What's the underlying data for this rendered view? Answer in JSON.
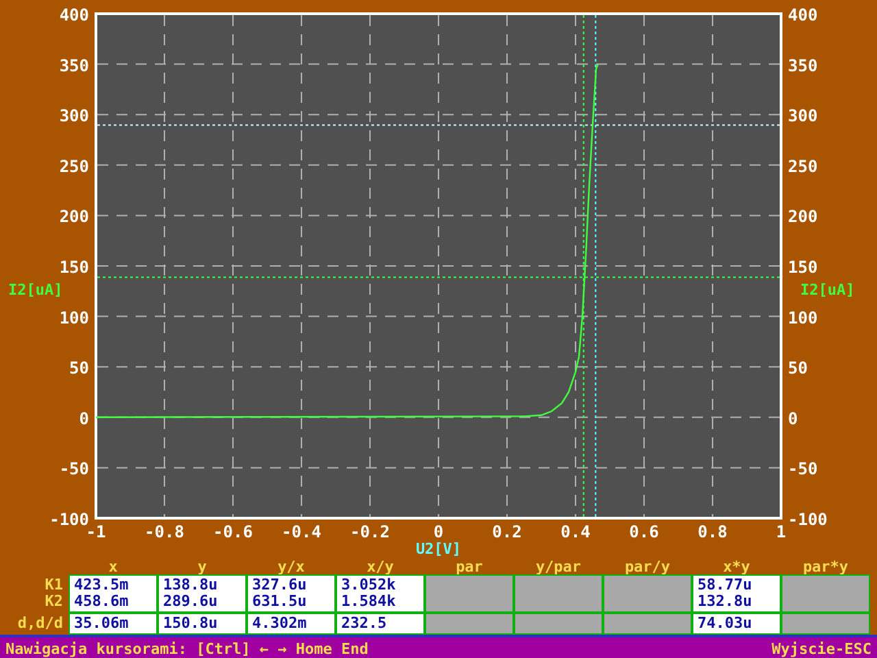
{
  "plot": {
    "chart_data": {
      "type": "line",
      "xlabel": "U2[V]",
      "ylabel": "I2[uA]",
      "xlim": [
        -1,
        1
      ],
      "ylim": [
        -100,
        400
      ],
      "grid": true,
      "xticks": [
        -1,
        -0.8,
        -0.6,
        -0.4,
        -0.2,
        0,
        0.2,
        0.4,
        0.6,
        0.8,
        1
      ],
      "yticks": [
        -100,
        -50,
        0,
        50,
        100,
        150,
        200,
        250,
        300,
        350,
        400
      ],
      "series": [
        {
          "color": "#40ff40",
          "x": [
            -1,
            0.25,
            0.3,
            0.33,
            0.36,
            0.38,
            0.4,
            0.41,
            0.42,
            0.43,
            0.44,
            0.45,
            0.46,
            0.465
          ],
          "values": [
            0,
            1,
            2,
            6,
            14,
            25,
            45,
            60,
            100,
            160,
            230,
            290,
            345,
            350
          ]
        }
      ],
      "ref_lines": [
        {
          "axis": "x",
          "value": 0.4235,
          "color": "#40ff40"
        },
        {
          "axis": "x",
          "value": 0.4586,
          "color": "#60ffff"
        },
        {
          "axis": "y",
          "value": 138.8,
          "color": "#40ff40"
        },
        {
          "axis": "y",
          "value": 289.6,
          "color": "#c0ffff"
        }
      ]
    },
    "right_yticks": [
      "400",
      "350",
      "300",
      "250",
      "200",
      "150",
      "100",
      "50",
      "0",
      "-50",
      "-100"
    ],
    "right_ylabel": "I2[uA]"
  },
  "table": {
    "columns": [
      "x",
      "y",
      "y/x",
      "x/y",
      "par",
      "y/par",
      "par/y",
      "x*y",
      "par*y"
    ],
    "blocks": [
      {
        "labels": [
          "K1",
          "K2"
        ],
        "cells": [
          {
            "kind": "value",
            "lines": [
              "423.5m",
              "458.6m"
            ]
          },
          {
            "kind": "value",
            "lines": [
              "138.8u",
              "289.6u"
            ]
          },
          {
            "kind": "value",
            "lines": [
              "327.6u",
              "631.5u"
            ]
          },
          {
            "kind": "value",
            "lines": [
              "3.052k",
              "1.584k"
            ]
          },
          {
            "kind": "blank"
          },
          {
            "kind": "blank"
          },
          {
            "kind": "blank"
          },
          {
            "kind": "value",
            "lines": [
              "58.77u",
              "132.8u"
            ]
          },
          {
            "kind": "blank"
          }
        ]
      },
      {
        "labels": [
          "d,d/d"
        ],
        "cells": [
          {
            "kind": "value",
            "lines": [
              "35.06m"
            ]
          },
          {
            "kind": "value",
            "lines": [
              "150.8u"
            ]
          },
          {
            "kind": "value",
            "lines": [
              "4.302m"
            ]
          },
          {
            "kind": "value",
            "lines": [
              "232.5"
            ]
          },
          {
            "kind": "blank"
          },
          {
            "kind": "blank"
          },
          {
            "kind": "blank"
          },
          {
            "kind": "value",
            "lines": [
              "74.03u"
            ]
          },
          {
            "kind": "blank"
          }
        ]
      }
    ]
  },
  "status_bar": {
    "hint": "Nawigacja kursorami: [Ctrl] ← → Home End",
    "exit": "Wyjscie-ESC"
  }
}
